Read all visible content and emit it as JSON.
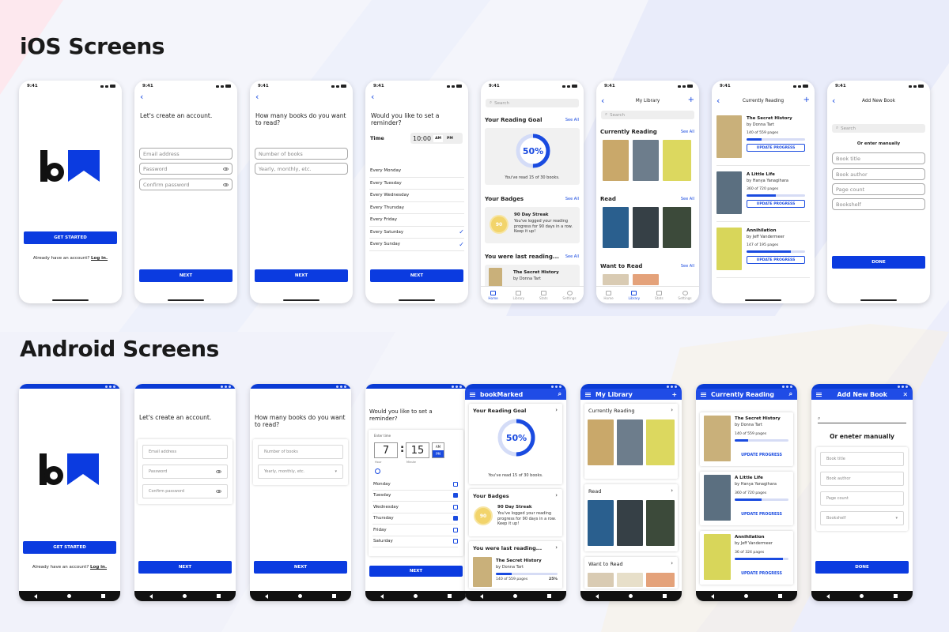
{
  "sections": {
    "ios": "iOS Screens",
    "android": "Android Screens"
  },
  "ios": {
    "time": "9:41",
    "s1": {
      "get_started": "GET STARTED",
      "already": "Already have an account?",
      "login": "Log in."
    },
    "s2": {
      "title": "Let's create an account.",
      "email": "Email address",
      "password": "Password",
      "confirm": "Confirm password",
      "next": "NEXT"
    },
    "s3": {
      "title": "How many books do you want to read?",
      "number": "Number of books",
      "period": "Yearly, monthly, etc.",
      "next": "NEXT"
    },
    "s4": {
      "title": "Would you like to set a reminder?",
      "time_label": "Time",
      "time_value": "10:00",
      "am": "AM",
      "pm": "PM",
      "days": [
        {
          "label": "Every Monday",
          "checked": false
        },
        {
          "label": "Every Tuesday",
          "checked": false
        },
        {
          "label": "Every Wednesday",
          "checked": false
        },
        {
          "label": "Every Thursday",
          "checked": false
        },
        {
          "label": "Every Friday",
          "checked": false
        },
        {
          "label": "Every Saturday",
          "checked": true
        },
        {
          "label": "Every Sunday",
          "checked": true
        }
      ],
      "next": "NEXT"
    },
    "s5": {
      "search": "Search",
      "goal_title": "Your Reading Goal",
      "see_all": "See All",
      "goal_pct": "50%",
      "goal_fraction": 0.5,
      "goal_text": "You've read 15 of 30 books.",
      "badges_title": "Your Badges",
      "badge_num": "90",
      "badge_title": "90 Day Streak",
      "badge_desc": "You've logged your reading progress for 90 days in a row. Keep it up!",
      "last_title": "You were last reading...",
      "last_book": "The Secret History",
      "last_author": "by Donna Tart",
      "tabs": [
        "Home",
        "Library",
        "Stats",
        "Settings"
      ]
    },
    "s6": {
      "title": "My Library",
      "search": "Search",
      "current": "Currently Reading",
      "read": "Read",
      "want": "Want to Read",
      "see_all": "See All",
      "tabs": [
        "Home",
        "Library",
        "Stats",
        "Settings"
      ]
    },
    "s7": {
      "title": "Currently Reading",
      "books": [
        {
          "title": "The Secret History",
          "author": "by Donna Tart",
          "pages": "140 of 559 pages",
          "progress": 0.25,
          "cover": "#c9b07a"
        },
        {
          "title": "A Little Life",
          "author": "by Hanya Yanagihara",
          "pages": "360 of 720 pages",
          "progress": 0.5,
          "cover": "#5b6f80"
        },
        {
          "title": "Annihilation",
          "author": "by Jeff Vandermeer",
          "pages": "147 of 195 pages",
          "progress": 0.75,
          "cover": "#d8d65a"
        }
      ],
      "update": "UPDATE PROGRESS"
    },
    "s8": {
      "title": "Add New Book",
      "search": "Search",
      "or": "Or enter manually",
      "fields": [
        "Book title",
        "Book author",
        "Page count",
        "Bookshelf"
      ],
      "done": "DONE"
    }
  },
  "android": {
    "a1": {
      "get_started": "GET STARTED",
      "already": "Already have an account?",
      "login": "Log in."
    },
    "a2": {
      "title": "Let's create an account.",
      "email": "Email address",
      "password": "Password",
      "confirm": "Confirm password",
      "next": "NEXT"
    },
    "a3": {
      "title": "How many books do you want to read?",
      "number": "Number of books",
      "period": "Yearly, monthly, etc.",
      "next": "NEXT"
    },
    "a4": {
      "title": "Would you like to set a reminder?",
      "enter_time": "Enter time",
      "hour": "7",
      "minute": "15",
      "hour_label": "Hour",
      "minute_label": "Minute",
      "am": "AM",
      "pm": "PM",
      "days": [
        {
          "label": "Monday",
          "checked": false
        },
        {
          "label": "Tuesday",
          "checked": true
        },
        {
          "label": "Wednesday",
          "checked": false
        },
        {
          "label": "Thursday",
          "checked": true
        },
        {
          "label": "Friday",
          "checked": false
        },
        {
          "label": "Saturday",
          "checked": false
        }
      ],
      "next": "NEXT"
    },
    "a5": {
      "title": "bookMarked",
      "goal_title": "Your Reading Goal",
      "goal_pct": "50%",
      "goal_fraction": 0.5,
      "goal_text": "You've read 15 of 30 books.",
      "badges_title": "Your Badges",
      "badge_num": "90",
      "badge_title": "90 Day Streak",
      "badge_desc": "You've logged your reading progress for 90 days in a row. Keep it up!",
      "last_title": "You were last reading...",
      "last_book": "The Secret History",
      "last_author": "by Donna Tart",
      "last_pages": "140 of 559 pages",
      "last_pct": "25%",
      "last_fraction": 0.25
    },
    "a6": {
      "title": "My Library",
      "current": "Currently Reading",
      "read": "Read",
      "want": "Want to Read"
    },
    "a7": {
      "title": "Currently Reading",
      "books": [
        {
          "title": "The Secret History",
          "author": "by Donna Tart",
          "pages": "140 of 559 pages",
          "progress": 0.25,
          "cover": "#c9b07a"
        },
        {
          "title": "A Little Life",
          "author": "by Hanya Yanagihara",
          "pages": "360 of 720 pages",
          "progress": 0.5,
          "cover": "#5b6f80"
        },
        {
          "title": "Annihilation",
          "author": "by Jeff Vandermeer",
          "pages": "36 of 324 pages",
          "progress": 0.9,
          "cover": "#d8d65a"
        }
      ],
      "update": "UPDATE PROGRESS"
    },
    "a8": {
      "title": "Add New Book",
      "or": "Or eneter manually",
      "fields": [
        "Book title",
        "Book author",
        "Page count",
        "Bookshelf"
      ],
      "done": "DONE"
    }
  },
  "colors": {
    "accent": "#1a4be0",
    "button": "#0b3be0",
    "android_bar": "#1f4ce6",
    "badge": "#f2d46b"
  }
}
